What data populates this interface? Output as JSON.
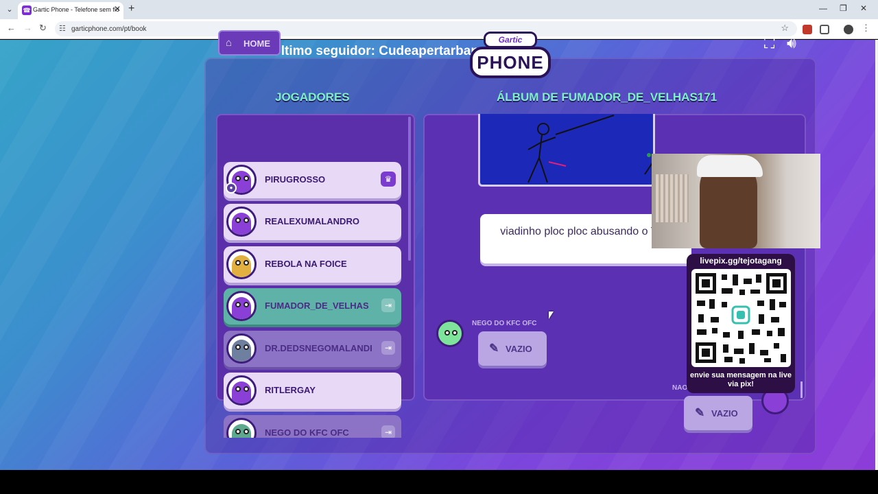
{
  "browser": {
    "tab_title": "Gartic Phone - Telefone sem fio",
    "url": "garticphone.com/pt/book"
  },
  "stream": {
    "last_follower": "Último seguidor: Cudeapertarbananacatura",
    "qr_url": "livepix.gg/tejotagang",
    "qr_caption": "envie sua mensagem na live via pix!"
  },
  "game": {
    "home_label": "HOME",
    "logo_top": "Gartic",
    "logo_main": "PHONE",
    "players_title": "JOGADORES",
    "album_title": "ÁLBUM DE FUMADOR_DE_VELHAS171",
    "players": [
      {
        "name": "PIRUGROSSO",
        "state": "host",
        "color": "#8a3fd6"
      },
      {
        "name": "REALEXUMALANDRO",
        "state": "normal",
        "color": "#8a3fd6"
      },
      {
        "name": "REBOLA NA FOICE",
        "state": "normal",
        "color": "#e2b040"
      },
      {
        "name": "FUMADOR_DE_VELHAS",
        "state": "active",
        "color": "#8a3fd6"
      },
      {
        "name": "DR.DEDSNEGOMALANDRO",
        "state": "left",
        "color": "#6f7fa0"
      },
      {
        "name": "RITLERGAY",
        "state": "normal",
        "color": "#8a3fd6"
      },
      {
        "name": "NEGO DO KFC OFC",
        "state": "left",
        "color": "#5fa890"
      }
    ],
    "guess_text": "viadinho ploc ploc abusando o TJ do",
    "messages": [
      {
        "author": "NEGO DO KFC OFC",
        "content": "VAZIO"
      },
      {
        "author": "NAO",
        "content": "VAZIO"
      }
    ]
  }
}
